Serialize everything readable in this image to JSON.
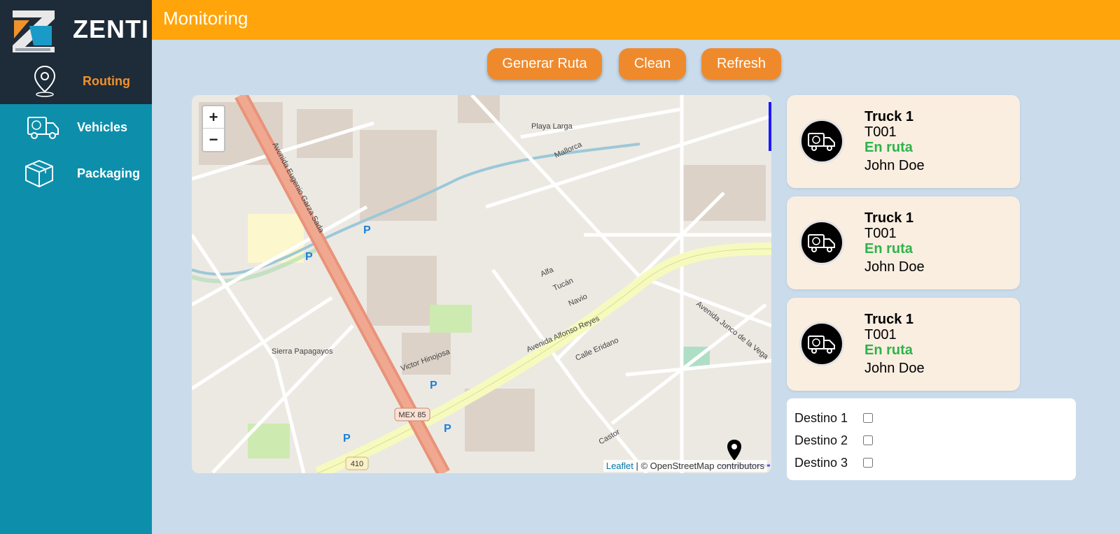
{
  "brand": {
    "name": "ZENTI"
  },
  "sidebar": {
    "items": [
      {
        "label": "Routing",
        "icon": "location-pin-icon",
        "active": true
      },
      {
        "label": "Vehicles",
        "icon": "delivery-truck-icon",
        "active": false
      },
      {
        "label": "Packaging",
        "icon": "package-box-icon",
        "active": false
      }
    ]
  },
  "header": {
    "title": "Monitoring"
  },
  "actions": {
    "generate_label": "Generar Ruta",
    "clean_label": "Clean",
    "refresh_label": "Refresh"
  },
  "map": {
    "zoom_in": "+",
    "zoom_out": "−",
    "attribution_leaflet": "Leaflet",
    "attribution_rest": " | © OpenStreetMap contributors",
    "labels": {
      "avenida_eugenio": "Avenida Eugenio Garza Sada",
      "avenida_alfonso": "Avenida Alfonso Reyes",
      "avenida_junco": "Avenida Junco de la Vega",
      "mex85": "MEX 85",
      "r410": "410",
      "playa_larga": "Playa Larga",
      "navio": "Navio",
      "tucan": "Tucán",
      "sierra_papagayos": "Sierra Papagayos",
      "victor_hinojosa": "Victor Hinojosa",
      "calle_eridano": "Calle Eridano",
      "castor": "Castor",
      "mallorca": "Mallorca",
      "alfa": "Alfa"
    }
  },
  "trucks": [
    {
      "name": "Truck 1",
      "code": "T001",
      "status": "En ruta",
      "driver": "John Doe"
    },
    {
      "name": "Truck 1",
      "code": "T001",
      "status": "En ruta",
      "driver": "John Doe"
    },
    {
      "name": "Truck 1",
      "code": "T001",
      "status": "En ruta",
      "driver": "John Doe"
    }
  ],
  "destinations": [
    {
      "label": "Destino 1",
      "checked": false
    },
    {
      "label": "Destino 2",
      "checked": false
    },
    {
      "label": "Destino 3",
      "checked": false
    }
  ],
  "colors": {
    "header": "#ffa40a",
    "sidebar": "#0d8fab",
    "sidebar_dark": "#1e2b38",
    "button": "#ef8a2c",
    "status_green": "#2db34a",
    "card_bg": "#faeee1"
  }
}
